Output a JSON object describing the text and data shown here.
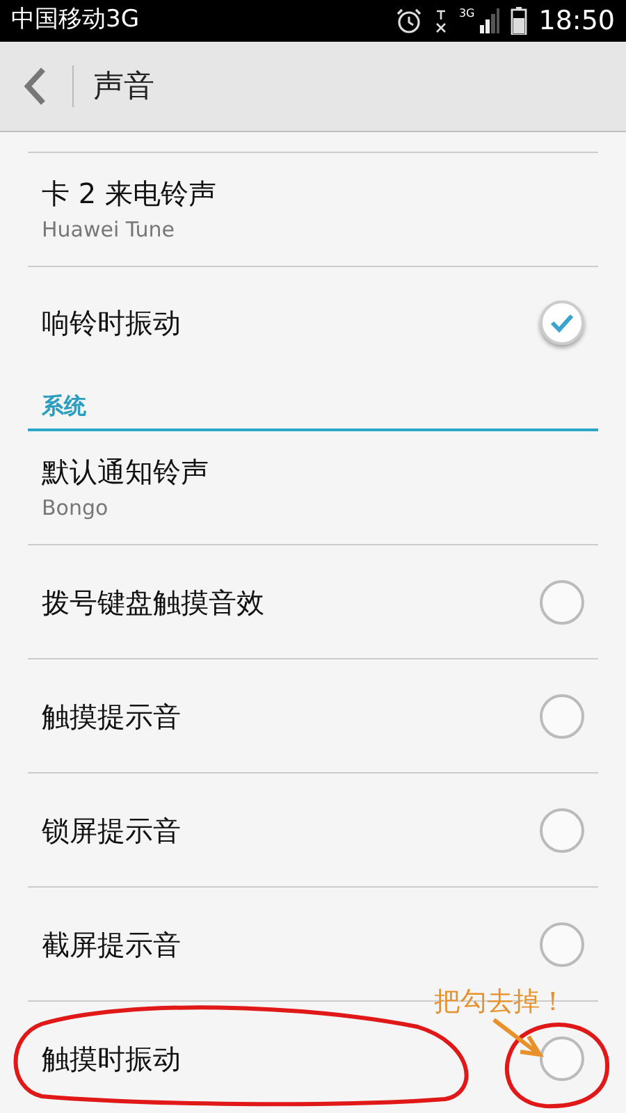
{
  "status_bar": {
    "carrier": "中国移动3G",
    "network": "3G",
    "time": "18:50"
  },
  "toolbar": {
    "title": "声音"
  },
  "items": [
    {
      "kind": "detail",
      "title": "卡 2 来电铃声",
      "summary": "Huawei Tune"
    },
    {
      "kind": "check",
      "title": "响铃时振动",
      "checked": true
    },
    {
      "kind": "header",
      "title": "系统"
    },
    {
      "kind": "detail",
      "title": "默认通知铃声",
      "summary": "Bongo"
    },
    {
      "kind": "check",
      "title": "拨号键盘触摸音效",
      "checked": false
    },
    {
      "kind": "check",
      "title": "触摸提示音",
      "checked": false
    },
    {
      "kind": "check",
      "title": "锁屏提示音",
      "checked": false
    },
    {
      "kind": "check",
      "title": "截屏提示音",
      "checked": false
    },
    {
      "kind": "check",
      "title": "触摸时振动",
      "checked": false
    }
  ],
  "annotation": {
    "note": "把勾去掉！"
  }
}
